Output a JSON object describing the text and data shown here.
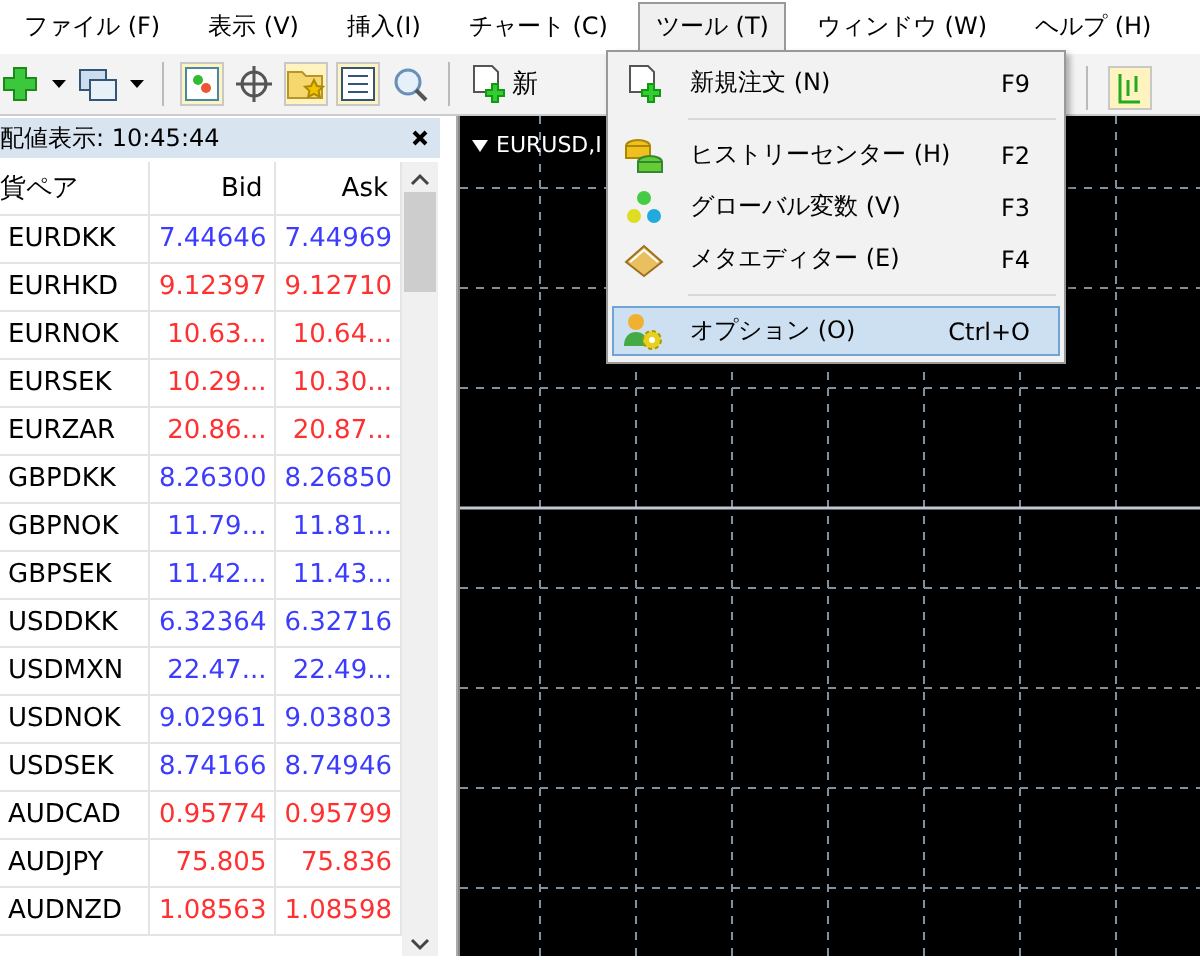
{
  "menu_bar": [
    {
      "label": "ファイル (F)",
      "selected": false
    },
    {
      "label": "表示 (V)",
      "selected": false
    },
    {
      "label": "挿入(I)",
      "selected": false
    },
    {
      "label": "チャート (C)",
      "selected": false
    },
    {
      "label": "ツール (T)",
      "selected": true
    },
    {
      "label": "ウィンドウ (W)",
      "selected": false
    },
    {
      "label": "ヘルプ (H)",
      "selected": false
    }
  ],
  "toolbar": {
    "new_order_label": "新"
  },
  "market_watch": {
    "title": "配値表示: 10:45:44",
    "columns": [
      "貨ペア",
      "Bid",
      "Ask"
    ],
    "rows": [
      {
        "symbol": "EURDKK",
        "bid": "7.44646",
        "ask": "7.44969",
        "color": "#3c3cff"
      },
      {
        "symbol": "EURHKD",
        "bid": "9.12397",
        "ask": "9.12710",
        "color": "#ff3030"
      },
      {
        "symbol": "EURNOK",
        "bid": "10.63...",
        "ask": "10.64...",
        "color": "#ff3030"
      },
      {
        "symbol": "EURSEK",
        "bid": "10.29...",
        "ask": "10.30...",
        "color": "#ff3030"
      },
      {
        "symbol": "EURZAR",
        "bid": "20.86...",
        "ask": "20.87...",
        "color": "#ff3030"
      },
      {
        "symbol": "GBPDKK",
        "bid": "8.26300",
        "ask": "8.26850",
        "color": "#3c3cff"
      },
      {
        "symbol": "GBPNOK",
        "bid": "11.79...",
        "ask": "11.81...",
        "color": "#3c3cff"
      },
      {
        "symbol": "GBPSEK",
        "bid": "11.42...",
        "ask": "11.43...",
        "color": "#3c3cff"
      },
      {
        "symbol": "USDDKK",
        "bid": "6.32364",
        "ask": "6.32716",
        "color": "#3c3cff"
      },
      {
        "symbol": "USDMXN",
        "bid": "22.47...",
        "ask": "22.49...",
        "color": "#3c3cff"
      },
      {
        "symbol": "USDNOK",
        "bid": "9.02961",
        "ask": "9.03803",
        "color": "#3c3cff"
      },
      {
        "symbol": "USDSEK",
        "bid": "8.74166",
        "ask": "8.74946",
        "color": "#3c3cff"
      },
      {
        "symbol": "AUDCAD",
        "bid": "0.95774",
        "ask": "0.95799",
        "color": "#ff3030"
      },
      {
        "symbol": "AUDJPY",
        "bid": "75.805",
        "ask": "75.836",
        "color": "#ff3030"
      },
      {
        "symbol": "AUDNZD",
        "bid": "1.08563",
        "ask": "1.08598",
        "color": "#ff3030"
      }
    ]
  },
  "chart": {
    "title": "EURUSD,I"
  },
  "tools_menu": {
    "items": [
      {
        "kind": "item",
        "label": "新規注文 (N)",
        "shortcut": "F9",
        "selected": false
      },
      {
        "kind": "separator"
      },
      {
        "kind": "item",
        "label": "ヒストリーセンター (H)",
        "shortcut": "F2",
        "selected": false
      },
      {
        "kind": "item",
        "label": "グローバル変数 (V)",
        "shortcut": "F3",
        "selected": false
      },
      {
        "kind": "item",
        "label": "メタエディター (E)",
        "shortcut": "F4",
        "selected": false
      },
      {
        "kind": "separator"
      },
      {
        "kind": "item",
        "label": "オプション (O)",
        "shortcut": "Ctrl+O",
        "selected": true
      }
    ]
  }
}
